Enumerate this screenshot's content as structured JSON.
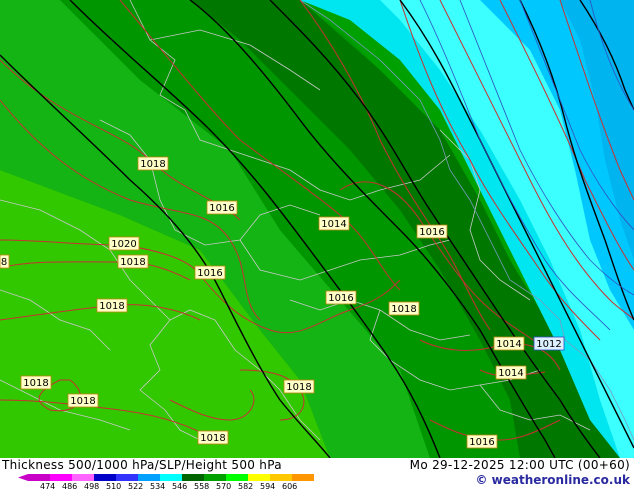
{
  "footer": {
    "title_left": "Thickness 500/1000 hPa/SLP/Height 500 hPa",
    "title_right": "Mo 29-12-2025 12:00 UTC (00+60)",
    "credit": "© weatheronline.co.uk"
  },
  "legend": {
    "values": [
      "474",
      "486",
      "498",
      "510",
      "522",
      "534",
      "546",
      "558",
      "570",
      "582",
      "594",
      "606"
    ],
    "colors": [
      "#c800c8",
      "#ff00ff",
      "#ff64ff",
      "#0000c8",
      "#3232ff",
      "#00a0ff",
      "#00ffff",
      "#006400",
      "#00a000",
      "#00ff00",
      "#ffff00",
      "#ffc800",
      "#ff9600"
    ]
  },
  "pressure_labels": [
    "1018",
    "1016",
    "1014",
    "1016",
    "1020",
    "1018",
    "1016",
    "8",
    "1018",
    "1016",
    "1018",
    "1014",
    "1012",
    "1014",
    "1018",
    "1018",
    "1018",
    "1018",
    "1016"
  ],
  "colors": {
    "isobar": "#c83232",
    "border": "#c8c8c8",
    "height_line": "#000000",
    "label_bg": "#ffffc8"
  }
}
